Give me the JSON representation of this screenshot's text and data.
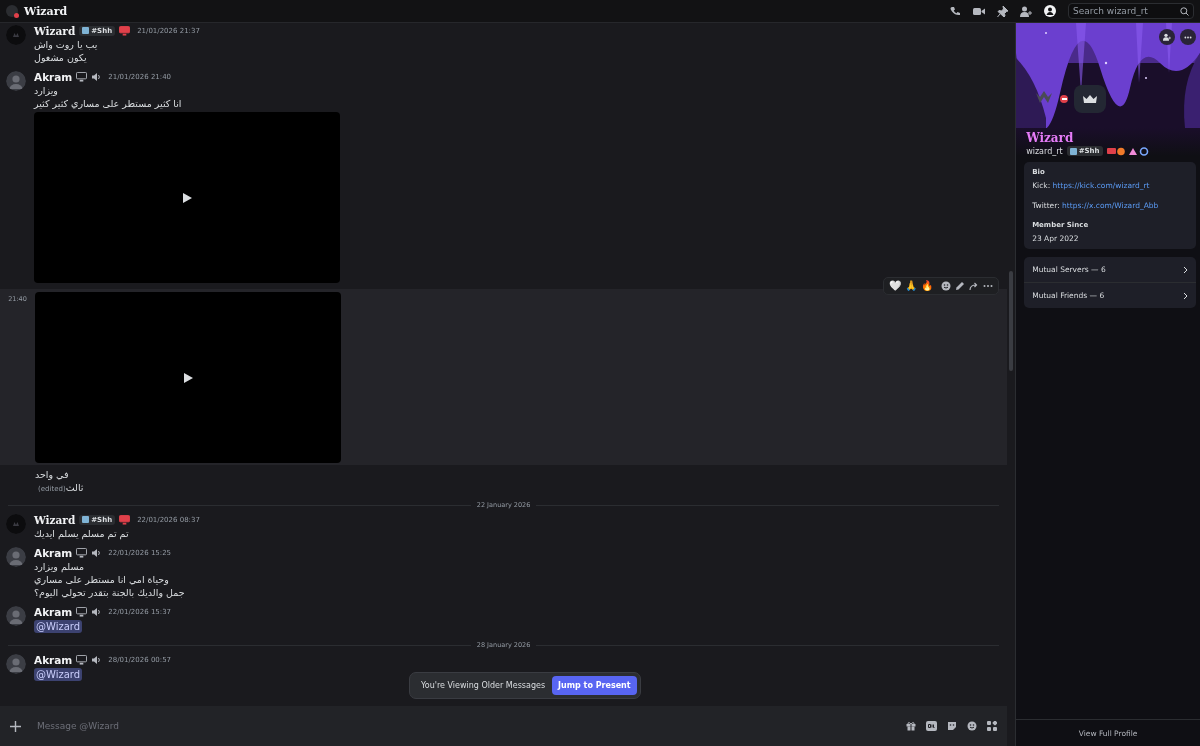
{
  "window": {
    "title": "Wizard"
  },
  "search": {
    "placeholder": "Search wizard_rt"
  },
  "messages": [
    {
      "kind": "message",
      "author": "Wizard",
      "guild_tag": "#Shh",
      "timestamp": "21/01/2026 21:37",
      "lines": [
        {
          "kind": "text",
          "text": "يب يا روت واش"
        },
        {
          "kind": "text",
          "text": "يكون مشغول"
        }
      ]
    },
    {
      "kind": "message",
      "author": "Akram",
      "timestamp": "21/01/2026 21:40",
      "lines": [
        {
          "kind": "text",
          "text": "ويزارد"
        },
        {
          "kind": "text",
          "text": "انا كثير مستطر على مساري كثير كثير"
        }
      ],
      "attachments": [
        {
          "kind": "video"
        }
      ]
    },
    {
      "kind": "continuation",
      "timestamp": "21:40",
      "hovered": true,
      "attachments": [
        {
          "kind": "video"
        }
      ],
      "reactions": [
        "🤍",
        "🙏",
        "🔥"
      ]
    },
    {
      "kind": "continuation",
      "hovered": false,
      "lines": [
        {
          "kind": "text",
          "text": "في واحد"
        },
        {
          "kind": "text",
          "text": "ثالث",
          "edited": "(edited)"
        }
      ]
    },
    {
      "kind": "divider",
      "text": "22 January 2026"
    },
    {
      "kind": "message",
      "author": "Wizard",
      "guild_tag": "#Shh",
      "timestamp": "22/01/2026 08:37",
      "lines": [
        {
          "kind": "text",
          "text": "تم تم مسلم يسلم ايديك"
        }
      ]
    },
    {
      "kind": "message",
      "author": "Akram",
      "timestamp": "22/01/2026 15:25",
      "lines": [
        {
          "kind": "text",
          "text": "مسلم ويزارد"
        },
        {
          "kind": "text",
          "text": "وحياة امي انا مستطر على مساري"
        },
        {
          "kind": "text",
          "text": "جمل والديك بالجنة بتقدر تحولي اليوم؟"
        }
      ]
    },
    {
      "kind": "message",
      "author": "Akram",
      "timestamp": "22/01/2026 15:37",
      "lines": [
        {
          "kind": "mention",
          "text": "@Wizard"
        }
      ]
    },
    {
      "kind": "divider",
      "text": "28 January 2026"
    },
    {
      "kind": "message",
      "author": "Akram",
      "timestamp": "28/01/2026 00:57",
      "lines": [
        {
          "kind": "mention",
          "text": "@Wizard"
        }
      ]
    }
  ],
  "older_bar": {
    "text": "You're Viewing Older Messages",
    "button": "Jump to Present"
  },
  "composer": {
    "placeholder": "Message @Wizard"
  },
  "profile": {
    "display_name": "Wizard",
    "username": "wizard_rt",
    "guild_tag": "#Shh",
    "do_not_disturb": true,
    "bio_label": "Bio",
    "bio_lines": [
      {
        "label": "Kick:",
        "link": "https://kick.com/wizard_rt"
      },
      {
        "label": "Twitter:",
        "link": "https://x.com/Wizard_Abb"
      }
    ],
    "member_since_label": "Member Since",
    "member_since": "23 Apr 2022",
    "mutuals": [
      "Mutual Servers — 6",
      "Mutual Friends — 6"
    ],
    "footer": "View Full Profile"
  }
}
